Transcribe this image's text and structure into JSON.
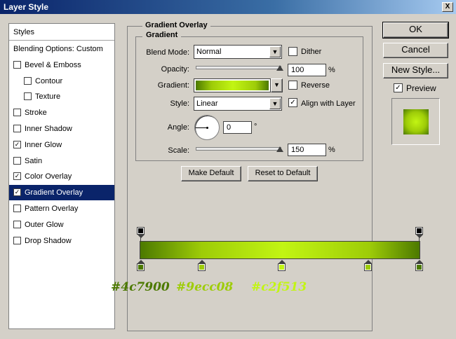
{
  "window": {
    "title": "Layer Style",
    "close_label": "X"
  },
  "styles_panel": {
    "header": "Styles",
    "items": [
      {
        "label": "Blending Options: Custom",
        "checkbox": false,
        "checked": false,
        "selected": false
      },
      {
        "label": "Bevel & Emboss",
        "checkbox": true,
        "checked": false,
        "selected": false
      },
      {
        "label": "Contour",
        "checkbox": true,
        "checked": false,
        "selected": false,
        "indent": true
      },
      {
        "label": "Texture",
        "checkbox": true,
        "checked": false,
        "selected": false,
        "indent": true
      },
      {
        "label": "Stroke",
        "checkbox": true,
        "checked": false,
        "selected": false
      },
      {
        "label": "Inner Shadow",
        "checkbox": true,
        "checked": false,
        "selected": false
      },
      {
        "label": "Inner Glow",
        "checkbox": true,
        "checked": true,
        "selected": false
      },
      {
        "label": "Satin",
        "checkbox": true,
        "checked": false,
        "selected": false
      },
      {
        "label": "Color Overlay",
        "checkbox": true,
        "checked": true,
        "selected": false
      },
      {
        "label": "Gradient Overlay",
        "checkbox": true,
        "checked": true,
        "selected": true
      },
      {
        "label": "Pattern Overlay",
        "checkbox": true,
        "checked": false,
        "selected": false
      },
      {
        "label": "Outer Glow",
        "checkbox": true,
        "checked": false,
        "selected": false
      },
      {
        "label": "Drop Shadow",
        "checkbox": true,
        "checked": false,
        "selected": false
      }
    ]
  },
  "gradient_overlay": {
    "title": "Gradient Overlay",
    "subtitle": "Gradient",
    "blend_mode_label": "Blend Mode:",
    "blend_mode_value": "Normal",
    "dither_label": "Dither",
    "dither_checked": false,
    "opacity_label": "Opacity:",
    "opacity_value": "100",
    "opacity_unit": "%",
    "opacity_level": 1.0,
    "gradient_label": "Gradient:",
    "reverse_label": "Reverse",
    "reverse_checked": false,
    "style_label": "Style:",
    "style_value": "Linear",
    "align_label": "Align with Layer",
    "align_checked": true,
    "angle_label": "Angle:",
    "angle_value": "0",
    "angle_unit": "°",
    "scale_label": "Scale:",
    "scale_value": "150",
    "scale_unit": "%",
    "scale_level": 1.0,
    "make_default_label": "Make Default",
    "reset_default_label": "Reset to Default"
  },
  "buttons": {
    "ok": "OK",
    "cancel": "Cancel",
    "new_style": "New Style...",
    "preview_label": "Preview",
    "preview_checked": true
  },
  "gradient_editor": {
    "colors": {
      "dark": "#4c7900",
      "mid": "#9ecc08",
      "light": "#c2f513",
      "opacity_stop": "#000000"
    },
    "annotations": [
      "#4c7900",
      "#9ecc08",
      "#c2f513"
    ]
  },
  "check_mark": "✓",
  "dropdown_arrow": "▼"
}
